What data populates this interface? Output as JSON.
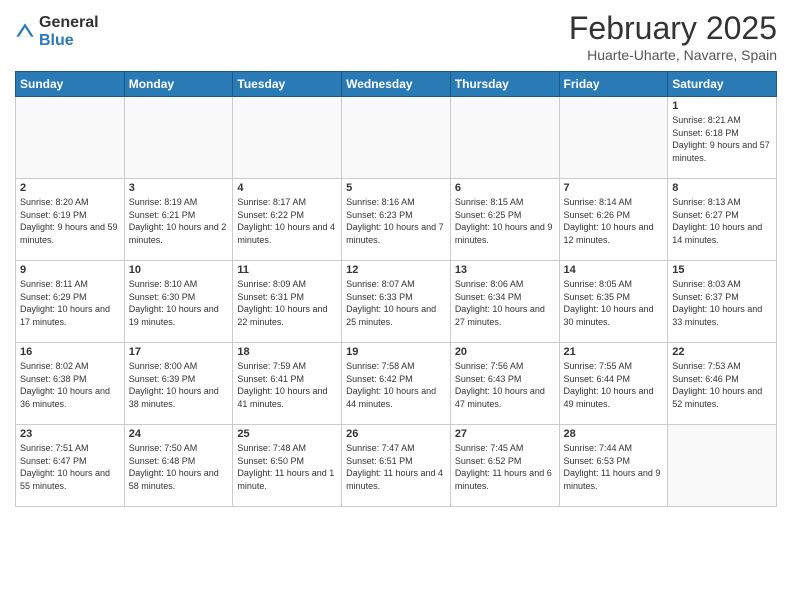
{
  "header": {
    "logo_general": "General",
    "logo_blue": "Blue",
    "month_title": "February 2025",
    "location": "Huarte-Uharte, Navarre, Spain"
  },
  "days_of_week": [
    "Sunday",
    "Monday",
    "Tuesday",
    "Wednesday",
    "Thursday",
    "Friday",
    "Saturday"
  ],
  "weeks": [
    [
      {
        "day": "",
        "info": ""
      },
      {
        "day": "",
        "info": ""
      },
      {
        "day": "",
        "info": ""
      },
      {
        "day": "",
        "info": ""
      },
      {
        "day": "",
        "info": ""
      },
      {
        "day": "",
        "info": ""
      },
      {
        "day": "1",
        "info": "Sunrise: 8:21 AM\nSunset: 6:18 PM\nDaylight: 9 hours and 57 minutes."
      }
    ],
    [
      {
        "day": "2",
        "info": "Sunrise: 8:20 AM\nSunset: 6:19 PM\nDaylight: 9 hours and 59 minutes."
      },
      {
        "day": "3",
        "info": "Sunrise: 8:19 AM\nSunset: 6:21 PM\nDaylight: 10 hours and 2 minutes."
      },
      {
        "day": "4",
        "info": "Sunrise: 8:17 AM\nSunset: 6:22 PM\nDaylight: 10 hours and 4 minutes."
      },
      {
        "day": "5",
        "info": "Sunrise: 8:16 AM\nSunset: 6:23 PM\nDaylight: 10 hours and 7 minutes."
      },
      {
        "day": "6",
        "info": "Sunrise: 8:15 AM\nSunset: 6:25 PM\nDaylight: 10 hours and 9 minutes."
      },
      {
        "day": "7",
        "info": "Sunrise: 8:14 AM\nSunset: 6:26 PM\nDaylight: 10 hours and 12 minutes."
      },
      {
        "day": "8",
        "info": "Sunrise: 8:13 AM\nSunset: 6:27 PM\nDaylight: 10 hours and 14 minutes."
      }
    ],
    [
      {
        "day": "9",
        "info": "Sunrise: 8:11 AM\nSunset: 6:29 PM\nDaylight: 10 hours and 17 minutes."
      },
      {
        "day": "10",
        "info": "Sunrise: 8:10 AM\nSunset: 6:30 PM\nDaylight: 10 hours and 19 minutes."
      },
      {
        "day": "11",
        "info": "Sunrise: 8:09 AM\nSunset: 6:31 PM\nDaylight: 10 hours and 22 minutes."
      },
      {
        "day": "12",
        "info": "Sunrise: 8:07 AM\nSunset: 6:33 PM\nDaylight: 10 hours and 25 minutes."
      },
      {
        "day": "13",
        "info": "Sunrise: 8:06 AM\nSunset: 6:34 PM\nDaylight: 10 hours and 27 minutes."
      },
      {
        "day": "14",
        "info": "Sunrise: 8:05 AM\nSunset: 6:35 PM\nDaylight: 10 hours and 30 minutes."
      },
      {
        "day": "15",
        "info": "Sunrise: 8:03 AM\nSunset: 6:37 PM\nDaylight: 10 hours and 33 minutes."
      }
    ],
    [
      {
        "day": "16",
        "info": "Sunrise: 8:02 AM\nSunset: 6:38 PM\nDaylight: 10 hours and 36 minutes."
      },
      {
        "day": "17",
        "info": "Sunrise: 8:00 AM\nSunset: 6:39 PM\nDaylight: 10 hours and 38 minutes."
      },
      {
        "day": "18",
        "info": "Sunrise: 7:59 AM\nSunset: 6:41 PM\nDaylight: 10 hours and 41 minutes."
      },
      {
        "day": "19",
        "info": "Sunrise: 7:58 AM\nSunset: 6:42 PM\nDaylight: 10 hours and 44 minutes."
      },
      {
        "day": "20",
        "info": "Sunrise: 7:56 AM\nSunset: 6:43 PM\nDaylight: 10 hours and 47 minutes."
      },
      {
        "day": "21",
        "info": "Sunrise: 7:55 AM\nSunset: 6:44 PM\nDaylight: 10 hours and 49 minutes."
      },
      {
        "day": "22",
        "info": "Sunrise: 7:53 AM\nSunset: 6:46 PM\nDaylight: 10 hours and 52 minutes."
      }
    ],
    [
      {
        "day": "23",
        "info": "Sunrise: 7:51 AM\nSunset: 6:47 PM\nDaylight: 10 hours and 55 minutes."
      },
      {
        "day": "24",
        "info": "Sunrise: 7:50 AM\nSunset: 6:48 PM\nDaylight: 10 hours and 58 minutes."
      },
      {
        "day": "25",
        "info": "Sunrise: 7:48 AM\nSunset: 6:50 PM\nDaylight: 11 hours and 1 minute."
      },
      {
        "day": "26",
        "info": "Sunrise: 7:47 AM\nSunset: 6:51 PM\nDaylight: 11 hours and 4 minutes."
      },
      {
        "day": "27",
        "info": "Sunrise: 7:45 AM\nSunset: 6:52 PM\nDaylight: 11 hours and 6 minutes."
      },
      {
        "day": "28",
        "info": "Sunrise: 7:44 AM\nSunset: 6:53 PM\nDaylight: 11 hours and 9 minutes."
      },
      {
        "day": "",
        "info": ""
      }
    ]
  ]
}
